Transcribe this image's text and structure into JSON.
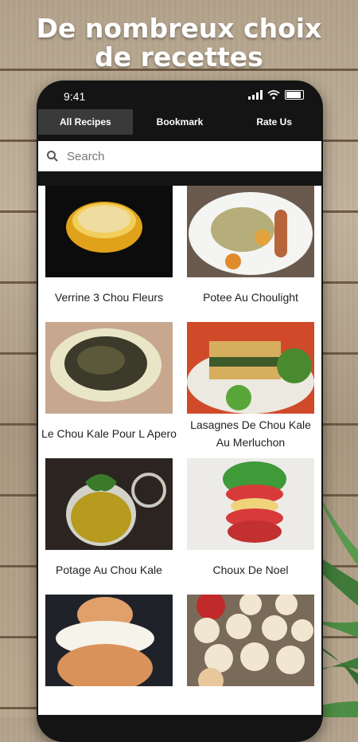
{
  "headline": {
    "line1": "De nombreux choix",
    "line2": "de recettes"
  },
  "status": {
    "time": "9:41"
  },
  "tabs": [
    {
      "label": "All Recipes",
      "active": true
    },
    {
      "label": "Bookmark",
      "active": false
    },
    {
      "label": "Rate Us",
      "active": false
    }
  ],
  "search": {
    "placeholder": "Search",
    "value": ""
  },
  "recipes": [
    {
      "title": "Verrine 3 Chou Fleurs"
    },
    {
      "title": "Potee Au Choulight"
    },
    {
      "title": "Le Chou Kale Pour L Apero"
    },
    {
      "title": "Lasagnes De Chou Kale Au Merluchon"
    },
    {
      "title": "Potage Au Chou Kale"
    },
    {
      "title": "Choux De Noel"
    },
    {
      "title": ""
    },
    {
      "title": ""
    }
  ]
}
